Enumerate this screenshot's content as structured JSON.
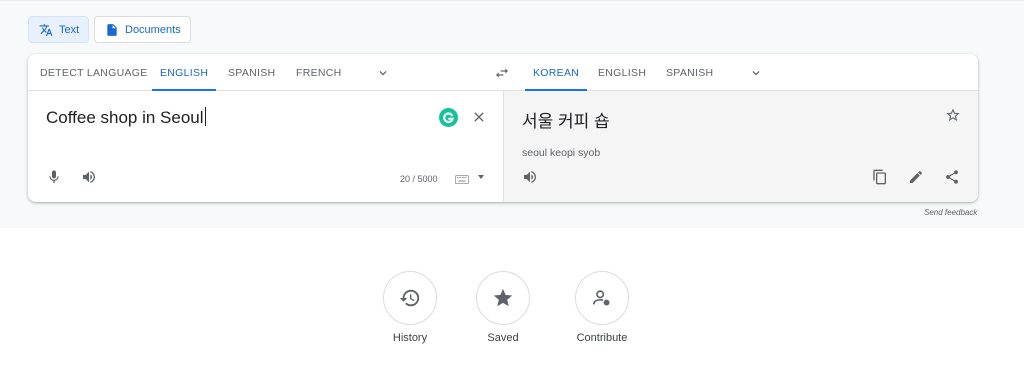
{
  "modes": {
    "text": {
      "label": "Text",
      "icon": "translate-icon"
    },
    "documents": {
      "label": "Documents",
      "icon": "document-icon"
    }
  },
  "source_languages": {
    "tabs": [
      "DETECT LANGUAGE",
      "ENGLISH",
      "SPANISH",
      "FRENCH"
    ],
    "active": "ENGLISH"
  },
  "target_languages": {
    "tabs": [
      "KOREAN",
      "ENGLISH",
      "SPANISH"
    ],
    "active": "KOREAN"
  },
  "source": {
    "text": "Coffee shop in Seoul",
    "char_count": "20 / 5000"
  },
  "target": {
    "text": "서울 커피 숍",
    "transliteration": "seoul keopi syob"
  },
  "feedback_link": "Send feedback",
  "bottom_actions": [
    {
      "label": "History",
      "icon": "history-icon"
    },
    {
      "label": "Saved",
      "icon": "star-icon"
    },
    {
      "label": "Contribute",
      "icon": "contribute-icon"
    }
  ],
  "colors": {
    "accent": "#1a73e8",
    "active_text": "#1967d2",
    "grammarly": "#15c39a"
  }
}
